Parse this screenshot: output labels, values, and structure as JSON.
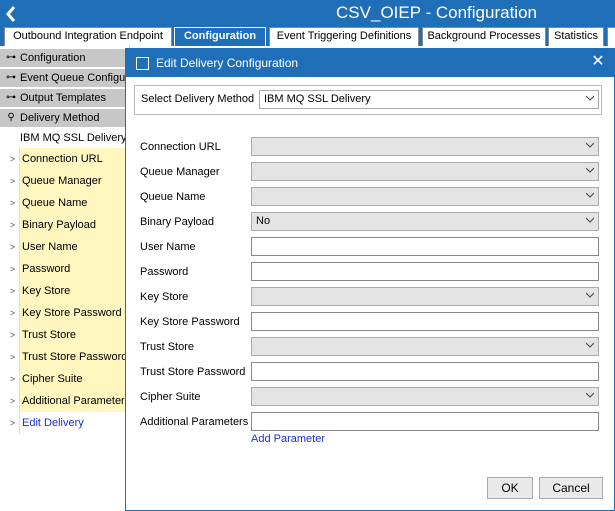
{
  "app": {
    "title": "CSV_OIEP - Configuration"
  },
  "tabs": [
    {
      "label": "Outbound Integration Endpoint"
    },
    {
      "label": "Configuration"
    },
    {
      "label": "Event Triggering Definitions"
    },
    {
      "label": "Background Processes"
    },
    {
      "label": "Statistics"
    }
  ],
  "tree": {
    "nodes": [
      {
        "label": "Configuration"
      },
      {
        "label": "Event Queue Configuration"
      },
      {
        "label": "Output Templates"
      },
      {
        "label": "Delivery Method"
      }
    ],
    "selected_method": "IBM MQ SSL Delivery",
    "rows": [
      {
        "label": "Connection URL"
      },
      {
        "label": "Queue Manager"
      },
      {
        "label": "Queue Name"
      },
      {
        "label": "Binary Payload"
      },
      {
        "label": "User Name"
      },
      {
        "label": "Password"
      },
      {
        "label": "Key Store"
      },
      {
        "label": "Key Store Password"
      },
      {
        "label": "Trust Store"
      },
      {
        "label": "Trust Store Password"
      },
      {
        "label": "Cipher Suite"
      },
      {
        "label": "Additional Parameters"
      }
    ],
    "edit_link": "Edit Delivery"
  },
  "dialog": {
    "title": "Edit Delivery Configuration",
    "select_method_label": "Select Delivery Method",
    "select_method_value": "IBM MQ SSL Delivery",
    "fields": [
      {
        "label": "Connection URL",
        "type": "select",
        "value": ""
      },
      {
        "label": "Queue Manager",
        "type": "select",
        "value": ""
      },
      {
        "label": "Queue Name",
        "type": "select",
        "value": ""
      },
      {
        "label": "Binary Payload",
        "type": "select",
        "value": "No"
      },
      {
        "label": "User Name",
        "type": "input",
        "value": ""
      },
      {
        "label": "Password",
        "type": "input",
        "value": ""
      },
      {
        "label": "Key Store",
        "type": "select",
        "value": ""
      },
      {
        "label": "Key Store Password",
        "type": "input",
        "value": ""
      },
      {
        "label": "Trust Store",
        "type": "select",
        "value": ""
      },
      {
        "label": "Trust Store Password",
        "type": "input",
        "value": ""
      },
      {
        "label": "Cipher Suite",
        "type": "select",
        "value": ""
      },
      {
        "label": "Additional Parameters",
        "type": "input",
        "value": ""
      }
    ],
    "add_parameter": "Add Parameter",
    "ok_label": "OK",
    "cancel_label": "Cancel"
  },
  "colors": {
    "accent": "#1e6fb8",
    "highlight": "#fff6c0",
    "link": "#1b2fd0"
  }
}
